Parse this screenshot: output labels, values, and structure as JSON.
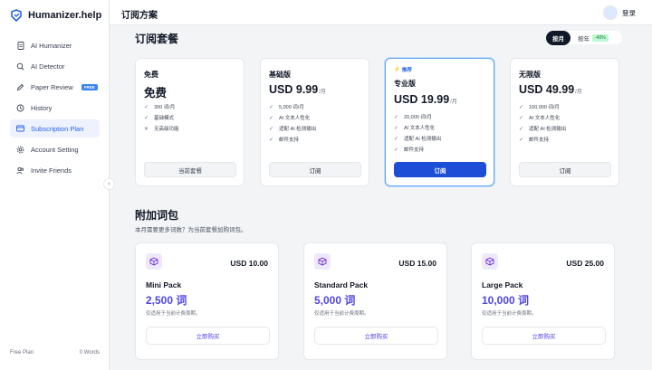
{
  "app": {
    "name": "Humanizer.help"
  },
  "sidebar": {
    "items": [
      {
        "label": "AI Humanizer",
        "icon": "file-icon"
      },
      {
        "label": "AI Detector",
        "icon": "search-icon"
      },
      {
        "label": "Paper Review",
        "icon": "pen-icon",
        "badge": "FREE"
      },
      {
        "label": "History",
        "icon": "history-icon"
      },
      {
        "label": "Subscription Plan",
        "icon": "card-icon",
        "active": true
      },
      {
        "label": "Account Setting",
        "icon": "gear-icon"
      },
      {
        "label": "Invite Friends",
        "icon": "users-icon"
      }
    ],
    "footer": {
      "plan": "Free Plan",
      "words": "0 Words"
    }
  },
  "header": {
    "title": "订阅方案",
    "login": "登录"
  },
  "subscription": {
    "title": "订阅套餐",
    "toggle": {
      "monthly": "按月",
      "yearly": "按年",
      "yearly_badge": "-40%"
    },
    "plans": [
      {
        "name": "免费",
        "price": "免费",
        "per": "",
        "features": [
          "300 词/月",
          "基础模式",
          "无高级功能"
        ],
        "feature_icons": [
          "check",
          "check",
          "cross"
        ],
        "button": "当前套餐"
      },
      {
        "name": "基础版",
        "price": "USD 9.99",
        "per": "/月",
        "features": [
          "5,000 词/月",
          "AI 文本人性化",
          "适配 AI 检测输出",
          "邮件支持"
        ],
        "button": "订阅"
      },
      {
        "name": "专业版",
        "recommended": "推荐",
        "price": "USD 19.99",
        "per": "/月",
        "features": [
          "20,000 词/月",
          "AI 文本人性化",
          "适配 AI 检测输出",
          "邮件支持"
        ],
        "button": "订阅"
      },
      {
        "name": "无限版",
        "price": "USD 49.99",
        "per": "/月",
        "features": [
          "100,000 词/月",
          "AI 文本人性化",
          "适配 AI 检测输出",
          "邮件支持"
        ],
        "button": "订阅"
      }
    ]
  },
  "addons": {
    "title": "附加词包",
    "subtitle": "本月需要更多词数？为当前套餐加购词包。",
    "packs": [
      {
        "name": "Mini Pack",
        "price": "USD 10.00",
        "words": "2,500 词",
        "note": "仅适用于当前计费周期。",
        "button": "立即购买"
      },
      {
        "name": "Standard Pack",
        "price": "USD 15.00",
        "words": "5,000 词",
        "note": "仅适用于当前计费周期。",
        "button": "立即购买"
      },
      {
        "name": "Large Pack",
        "price": "USD 25.00",
        "words": "10,000 词",
        "note": "仅适用于当前计费周期。",
        "button": "立即购买"
      }
    ]
  },
  "colors": {
    "accent": "#2563eb",
    "primary_button": "#1d4ed8",
    "addon_accent": "#4f46e5"
  }
}
